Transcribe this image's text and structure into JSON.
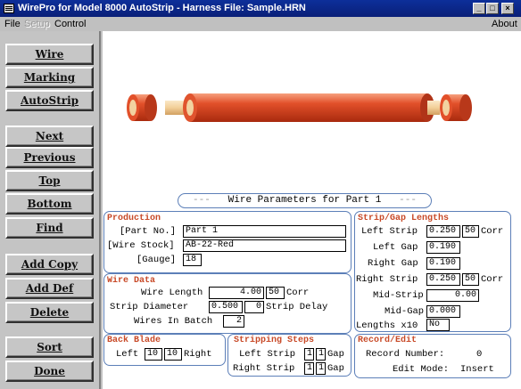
{
  "window": {
    "title": "WirePro for Model 8000 AutoStrip - Harness File: Sample.HRN",
    "minimize_glyph": "_",
    "maximize_glyph": "□",
    "close_glyph": "×"
  },
  "menu": {
    "file": "File",
    "setup": "Setup",
    "control": "Control",
    "about": "About"
  },
  "buttons": {
    "wire": "Wire",
    "marking": "Marking",
    "autostrip": "AutoStrip",
    "next": "Next",
    "previous": "Previous",
    "top": "Top",
    "bottom": "Bottom",
    "find": "Find",
    "add_copy": "Add Copy",
    "add_def": "Add Def",
    "delete": "Delete",
    "sort": "Sort",
    "done": "Done"
  },
  "params": {
    "header": "Wire Parameters for Part 1",
    "header_dashes": "---",
    "production": {
      "title": "Production",
      "part_no_label": "[Part No.]",
      "part_no": "Part 1",
      "wire_stock_label": "[Wire Stock]",
      "wire_stock": "AB-22-Red",
      "gauge_label": "[Gauge]",
      "gauge": "18"
    },
    "wire_data": {
      "title": "Wire Data",
      "wire_length_label": "Wire Length",
      "wire_length": "4.00",
      "wire_length_corr": "50",
      "corr_label": "Corr",
      "strip_diameter_label": "Strip Diameter",
      "strip_diameter": "0.500",
      "strip_delay": "0",
      "strip_delay_label": "Strip Delay",
      "wires_in_batch_label": "Wires In Batch",
      "wires_in_batch": "2"
    },
    "back_blade": {
      "title": "Back Blade",
      "left_label": "Left",
      "left": "10",
      "right": "10",
      "right_label": "Right"
    },
    "stripping_steps": {
      "title": "Stripping Steps",
      "left_label": "Left Strip",
      "left_a": "1",
      "left_b": "1",
      "gap_label": "Gap",
      "right_label": "Right Strip",
      "right_a": "1",
      "right_b": "1"
    },
    "strip_gap": {
      "title": "Strip/Gap Lengths",
      "left_strip_label": "Left Strip",
      "left_strip": "0.250",
      "left_strip_corr": "50",
      "corr_label": "Corr",
      "left_gap_label": "Left Gap",
      "left_gap": "0.190",
      "right_gap_label": "Right Gap",
      "right_gap": "0.190",
      "right_strip_label": "Right Strip",
      "right_strip": "0.250",
      "right_strip_corr": "50",
      "mid_strip_label": "Mid-Strip",
      "mid_strip": "0.00",
      "mid_gap_label": "Mid-Gap",
      "mid_gap": "0.000",
      "lengths_label": "Lengths x10",
      "lengths": "No"
    },
    "record_edit": {
      "title": "Record/Edit",
      "record_number_label": "Record Number:",
      "record_number": "0",
      "edit_mode_label": "Edit Mode:",
      "edit_mode": "Insert"
    }
  },
  "colors": {
    "wire": "#d8401c",
    "title_accent": "#c84a28",
    "group_border": "#5c7fb8",
    "titlebar": "#0d2f9a"
  }
}
